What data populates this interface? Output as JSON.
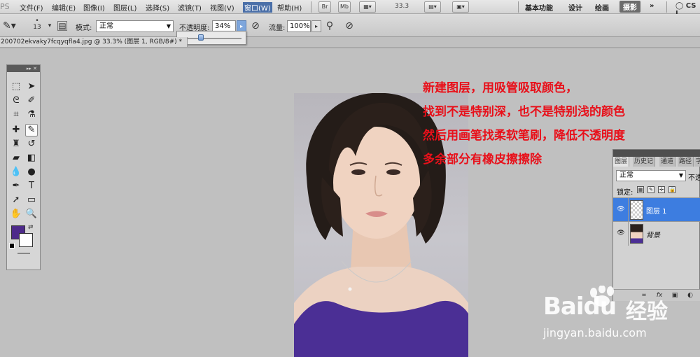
{
  "app": {
    "logo": "PS"
  },
  "menu": [
    "文件(F)",
    "编辑(E)",
    "图像(I)",
    "图层(L)",
    "选择(S)",
    "滤镜(T)",
    "视图(V)",
    "窗口(W)",
    "帮助(H)"
  ],
  "menubar_buttons": {
    "bridge": "Br",
    "mini_bridge": "Mb",
    "zoom_level": "33.3"
  },
  "workspaces": [
    "基本功能",
    "设计",
    "绘画",
    "摄影"
  ],
  "active_workspace": "摄影",
  "cs_live": "CS L",
  "options": {
    "brush_size": "13",
    "mode_label": "模式:",
    "mode_value": "正常",
    "opacity_label": "不透明度:",
    "opacity_value": "34%",
    "flow_label": "流量:",
    "flow_value": "100%"
  },
  "document": {
    "tab_title": "200702ekvaky7fcqyqfla4.jpg @ 33.3% (图层 1, RGB/8#) *"
  },
  "annotation": {
    "lines": [
      "新建图层，用吸管吸取颜色，",
      "找到不是特别深，也不是特别浅的颜色",
      "然后用画笔找柔软笔刷，降低不透明度",
      "多余部分有橡皮擦擦除"
    ]
  },
  "colors": {
    "foreground": "#4d2a8a",
    "background": "#ffffff",
    "annotation": "#e8101a",
    "selected_layer": "#3d7de0"
  },
  "layers_panel": {
    "tabs": [
      "图层",
      "历史记",
      "通道",
      "路径",
      "字"
    ],
    "blend_mode": "正常",
    "opacity_label": "不透",
    "lock_label": "锁定:",
    "layers": [
      {
        "name": "图层 1",
        "selected": true,
        "visible": true
      },
      {
        "name": "背景",
        "selected": false,
        "visible": true
      }
    ]
  },
  "watermark": {
    "brand": "Baidu",
    "brand_cn": "经验",
    "url": "jingyan.baidu.com"
  }
}
